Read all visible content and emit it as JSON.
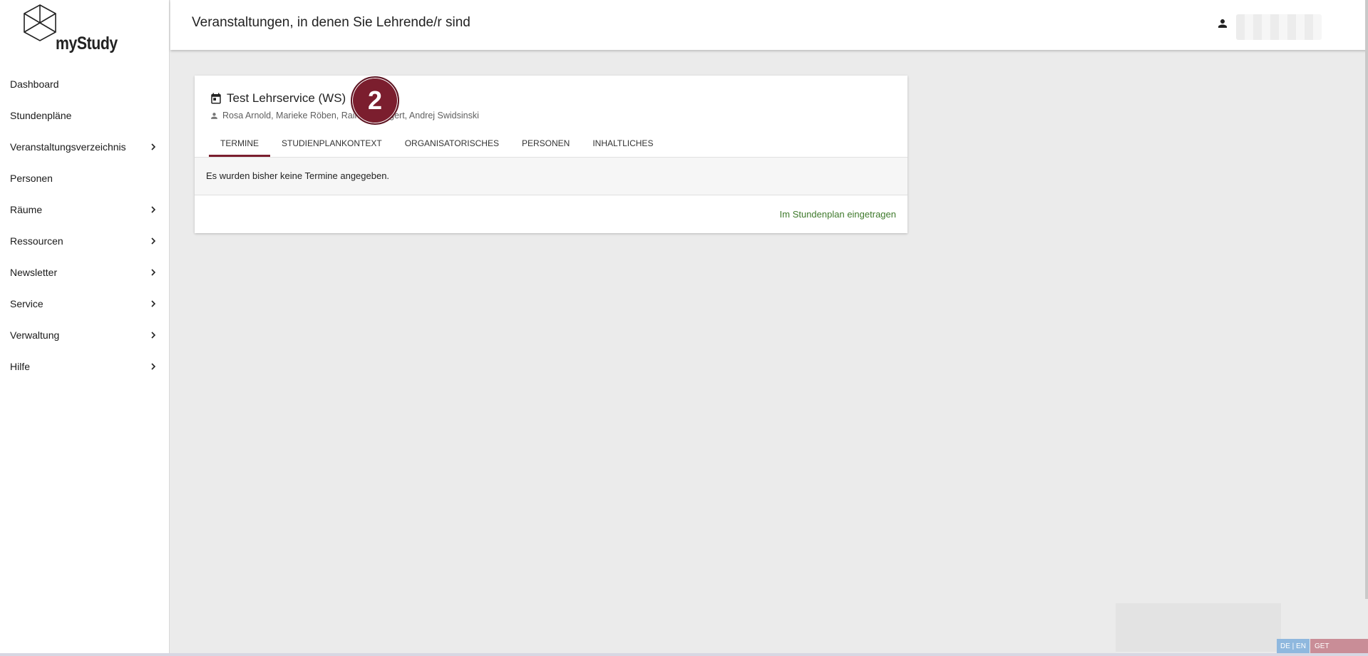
{
  "app": {
    "logo_text": "myStudy"
  },
  "sidebar": {
    "items": [
      {
        "label": "Dashboard",
        "has_children": false
      },
      {
        "label": "Stundenpläne",
        "has_children": false
      },
      {
        "label": "Veranstaltungsverzeichnis",
        "has_children": true
      },
      {
        "label": "Personen",
        "has_children": false
      },
      {
        "label": "Räume",
        "has_children": true
      },
      {
        "label": "Ressourcen",
        "has_children": true
      },
      {
        "label": "Newsletter",
        "has_children": true
      },
      {
        "label": "Service",
        "has_children": true
      },
      {
        "label": "Verwaltung",
        "has_children": true
      },
      {
        "label": "Hilfe",
        "has_children": true
      }
    ]
  },
  "header": {
    "title": "Veranstaltungen, in denen Sie Lehrende/r sind",
    "user_icon": "person-icon",
    "user_name": ""
  },
  "course": {
    "title": "Test Lehrservice (WS)",
    "lecturers": "Rosa Arnold, Marieke Röben, Rain            gert, Andrej Swidsinski",
    "tabs": [
      {
        "label": "TERMINE",
        "active": true
      },
      {
        "label": "STUDIENPLANKONTEXT",
        "active": false
      },
      {
        "label": "ORGANISATORISCHES",
        "active": false
      },
      {
        "label": "PERSONEN",
        "active": false
      },
      {
        "label": "INHALTLICHES",
        "active": false
      }
    ],
    "empty_message": "Es wurden bisher keine Termine angegeben.",
    "action_label": "Im Stundenplan eingetragen"
  },
  "step_badge": {
    "number": "2"
  },
  "footer": {
    "lang_label": "DE | EN",
    "support_label": "GET SUPPORT!"
  },
  "colors": {
    "accent": "#7b1e2e",
    "action_green": "#3f7a2c",
    "background": "#ebebeb"
  }
}
